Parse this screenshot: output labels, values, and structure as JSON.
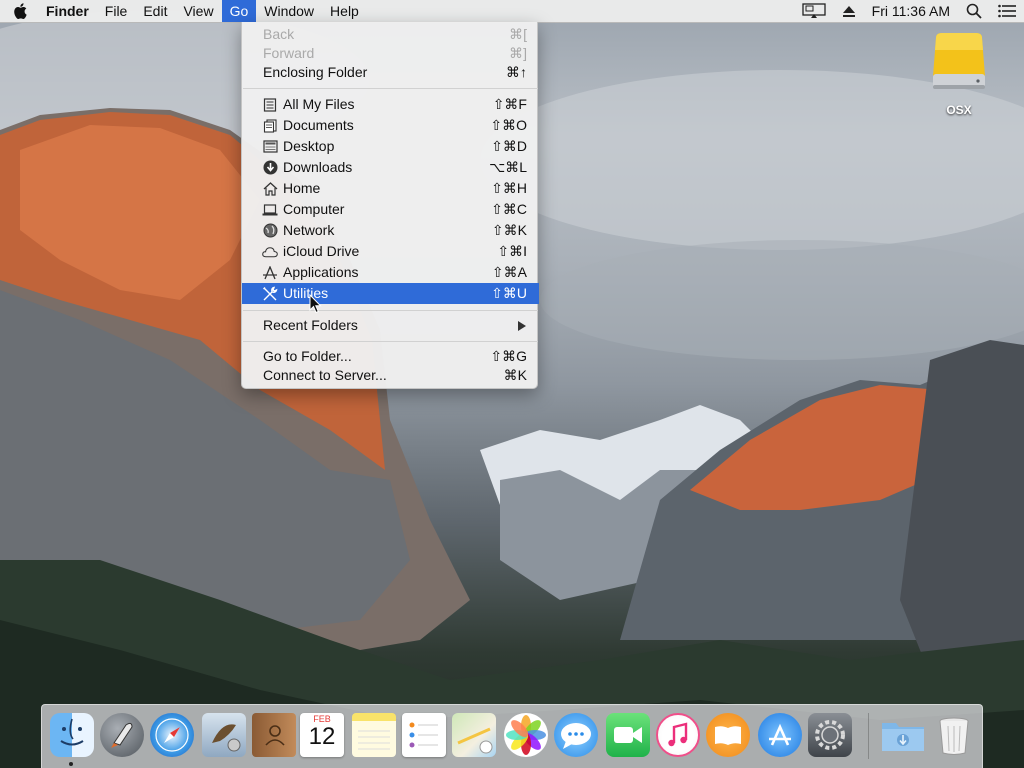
{
  "menubar": {
    "app_name": "Finder",
    "menus": [
      "File",
      "Edit",
      "View",
      "Go",
      "Window",
      "Help"
    ],
    "clock": "Fri 11:36 AM"
  },
  "go_menu": {
    "group1": [
      {
        "label": "Back",
        "shortcut": "⌘[",
        "disabled": true
      },
      {
        "label": "Forward",
        "shortcut": "⌘]",
        "disabled": true
      },
      {
        "label": "Enclosing Folder",
        "shortcut": "⌘↑"
      }
    ],
    "group2": [
      {
        "label": "All My Files",
        "shortcut": "⇧⌘F",
        "icon": "all-my-files-icon"
      },
      {
        "label": "Documents",
        "shortcut": "⇧⌘O",
        "icon": "documents-icon"
      },
      {
        "label": "Desktop",
        "shortcut": "⇧⌘D",
        "icon": "desktop-icon"
      },
      {
        "label": "Downloads",
        "shortcut": "⌥⌘L",
        "icon": "downloads-icon"
      },
      {
        "label": "Home",
        "shortcut": "⇧⌘H",
        "icon": "home-icon"
      },
      {
        "label": "Computer",
        "shortcut": "⇧⌘C",
        "icon": "computer-icon"
      },
      {
        "label": "Network",
        "shortcut": "⇧⌘K",
        "icon": "network-icon"
      },
      {
        "label": "iCloud Drive",
        "shortcut": "⇧⌘I",
        "icon": "icloud-icon"
      },
      {
        "label": "Applications",
        "shortcut": "⇧⌘A",
        "icon": "applications-icon"
      },
      {
        "label": "Utilities",
        "shortcut": "⇧⌘U",
        "icon": "utilities-icon",
        "highlighted": true
      }
    ],
    "recent_folders": "Recent Folders",
    "group4": [
      {
        "label": "Go to Folder...",
        "shortcut": "⇧⌘G"
      },
      {
        "label": "Connect to Server...",
        "shortcut": "⌘K"
      }
    ]
  },
  "desktop": {
    "drive_label": "OSX"
  },
  "dock": {
    "calendar_month": "FEB",
    "calendar_day": "12",
    "apps": [
      "finder-icon",
      "launchpad-icon",
      "safari-icon",
      "mail-icon",
      "contacts-icon",
      "calendar-icon",
      "notes-icon",
      "reminders-icon",
      "maps-icon",
      "photos-icon",
      "messages-icon",
      "facetime-icon",
      "itunes-icon",
      "ibooks-icon",
      "app-store-icon",
      "system-preferences-icon",
      "downloads-folder-icon",
      "trash-icon"
    ]
  },
  "colors": {
    "menu_highlight": "#2f6bd8",
    "menubar_bg": "#ececec"
  }
}
